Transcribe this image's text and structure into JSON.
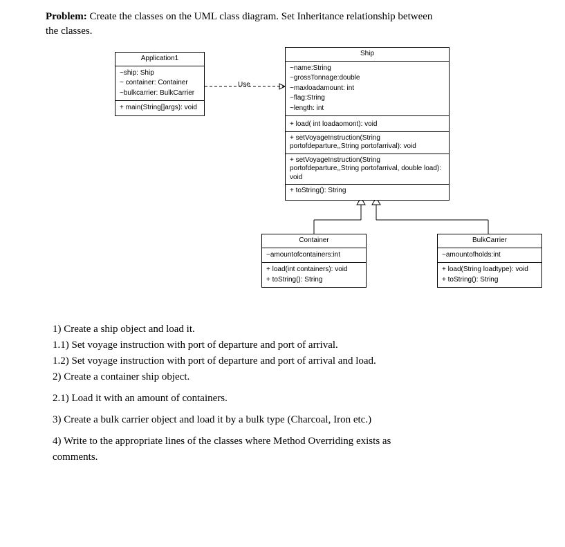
{
  "header": {
    "label": "Problem:",
    "text_a": "Create the classes on the UML class diagram. Set Inheritance relationship between",
    "text_b": "the classes."
  },
  "uml": {
    "use_label": "Use",
    "application": {
      "name": "Application1",
      "attrs": [
        "~ship: Ship",
        "~ container: Container",
        "~bulkcarrier: BulkCarrier"
      ],
      "ops": [
        "+ main(String[]args): void"
      ]
    },
    "ship": {
      "name": "Ship",
      "attrs": [
        "~name:String",
        "~grossTonnage:double",
        "~maxloadamount: int",
        "~flag:String",
        "~length: int"
      ],
      "ops": [
        "+ load( int loadaomont): void",
        "+ setVoyageInstruction(String portofdeparture,,String portofarrival): void",
        "+ setVoyageInstruction(String portofdeparture,,String portofarrival, double load): void",
        "+ toString(): String"
      ]
    },
    "container": {
      "name": "Container",
      "attrs": [
        "~amountofcontainers:int"
      ],
      "ops": [
        "+ load(int containers): void",
        "+ toString(): String"
      ]
    },
    "bulkcarrier": {
      "name": "BulkCarrier",
      "attrs": [
        "~amountofholds:int"
      ],
      "ops": [
        "+ load(String loadtype): void",
        "+ toString(): String"
      ]
    }
  },
  "tasks": {
    "t1": "1)   Create a ship object and load it.",
    "t1_1": "1.1)     Set voyage instruction with port of departure and port of arrival.",
    "t1_2": "1.2)     Set voyage instruction with port of departure and port of arrival and load.",
    "t2": "2)   Create a container ship object.",
    "t2_1": "2.1) Load it with an amount of containers.",
    "t3": "3) Create a bulk carrier object and load it by a bulk type (Charcoal, Iron etc.)",
    "t4a": "4) Write to the appropriate lines of the classes where Method Overriding exists as",
    "t4b": "comments."
  }
}
